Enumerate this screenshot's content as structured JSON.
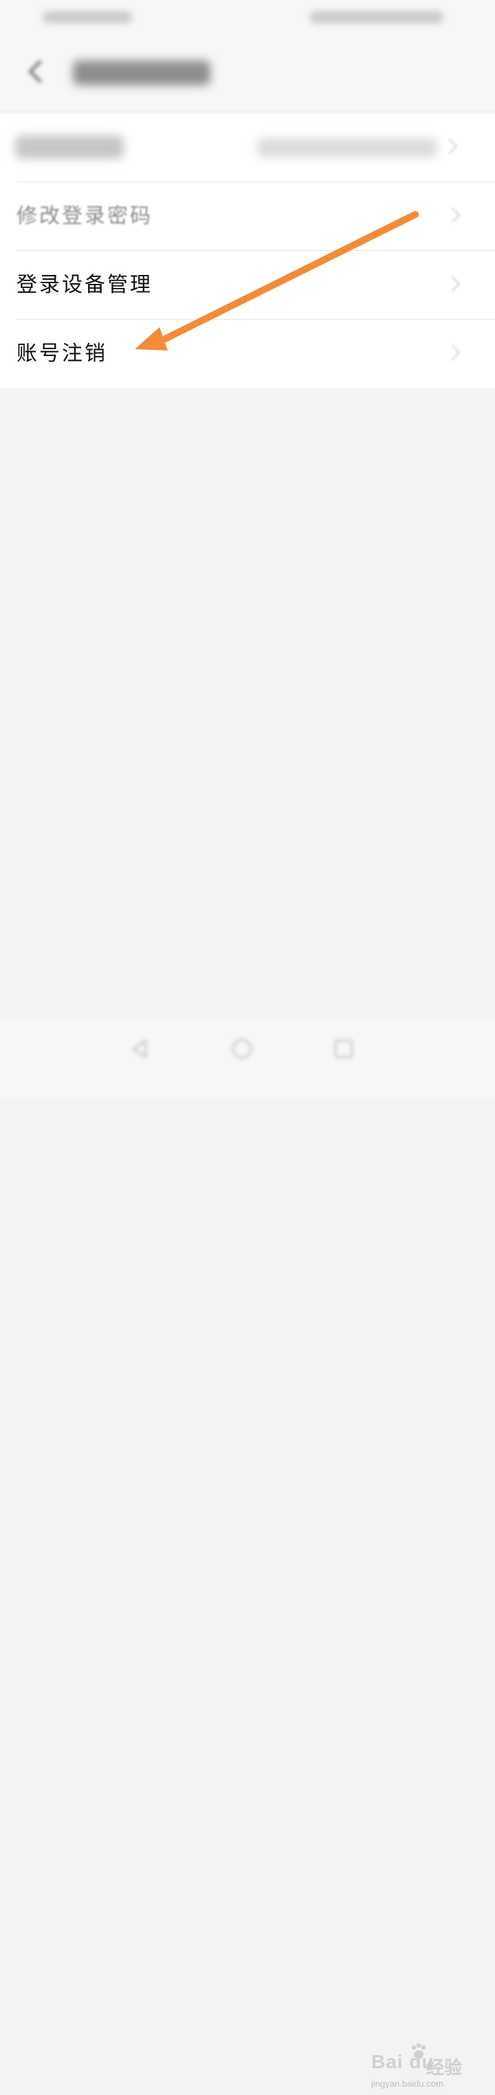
{
  "menu": {
    "items": [
      {
        "label": "修改登录密码"
      },
      {
        "label": "登录设备管理"
      },
      {
        "label": "账号注销"
      }
    ]
  },
  "annotation": {
    "arrow_color": "#f28c3a"
  },
  "watermark": {
    "logo": "Bai du",
    "text": "经验",
    "url": "jingyan.baidu.com"
  },
  "icons": {
    "back": "back-arrow-icon",
    "chevron": "chevron-right-icon",
    "nav_back": "nav-back-icon",
    "nav_home": "nav-home-icon",
    "nav_recent": "nav-recent-icon"
  }
}
